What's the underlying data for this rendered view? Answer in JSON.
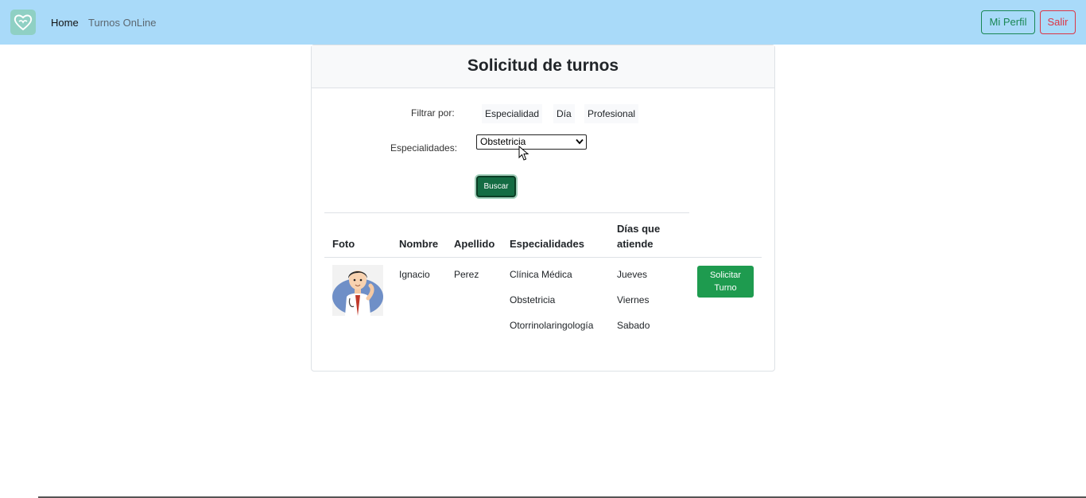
{
  "navbar": {
    "home": "Home",
    "turnos_online": "Turnos OnLine",
    "mi_perfil": "Mi Perfil",
    "salir": "Salir"
  },
  "card": {
    "title": "Solicitud de turnos"
  },
  "filters": {
    "label": "Filtrar por:",
    "options": [
      "Especialidad",
      "Día",
      "Profesional"
    ]
  },
  "especialidades": {
    "label": "Especialidades:",
    "selected": "Obstetricia"
  },
  "buscar_label": "Buscar",
  "table": {
    "headers": {
      "foto": "Foto",
      "nombre": "Nombre",
      "apellido": "Apellido",
      "especialidades": "Especialidades",
      "dias": "Días que atiende"
    },
    "rows": [
      {
        "nombre": "Ignacio",
        "apellido": "Perez",
        "especialidades": [
          "Clínica Médica",
          "Obstetricia",
          "Otorrinolaringología"
        ],
        "dias": [
          "Jueves",
          "Viernes",
          "Sabado"
        ],
        "action": "Solicitar Turno"
      }
    ]
  },
  "colors": {
    "navbar_bg": "#a9daf9",
    "success": "#198754",
    "danger": "#dc3545"
  }
}
